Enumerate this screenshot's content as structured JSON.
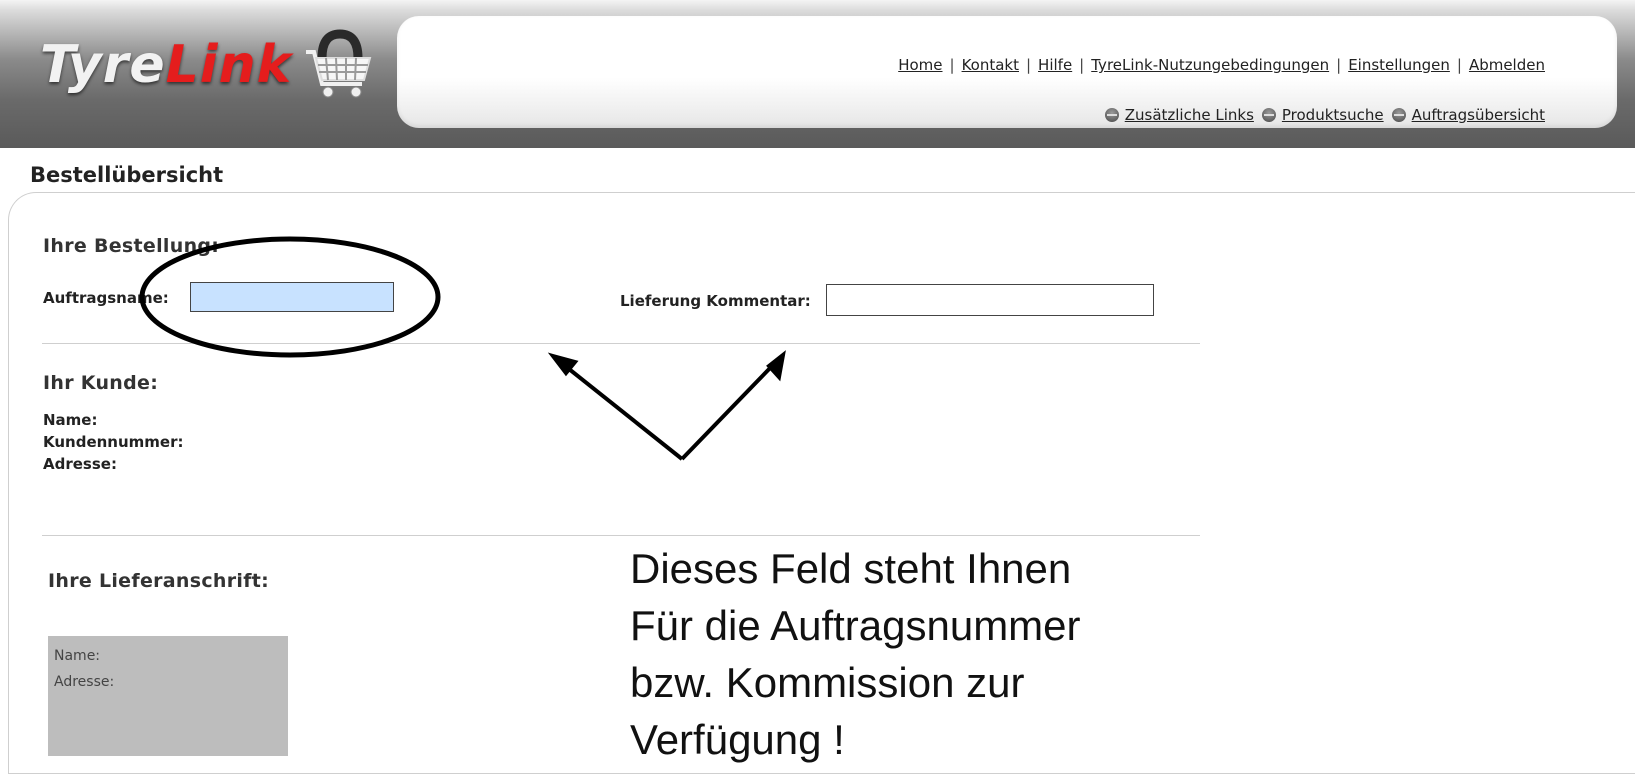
{
  "logo": {
    "part1": "Tyre",
    "part2": "Link"
  },
  "header": {
    "links": [
      "Home",
      "Kontakt",
      "Hilfe",
      "TyreLink-Nutzungebedingungen",
      "Einstellungen",
      "Abmelden"
    ],
    "separator": "|",
    "sublinks": [
      "Zusätzliche Links",
      "Produktsuche",
      "Auftragsübersicht"
    ]
  },
  "page": {
    "title": "Bestellübersicht"
  },
  "order": {
    "title": "Ihre Bestellung:",
    "auftragsname_label": "Auftragsname:",
    "auftragsname_value": "",
    "kommentar_label": "Lieferung Kommentar:",
    "kommentar_value": ""
  },
  "customer": {
    "title": "Ihr Kunde:",
    "name_label": "Name:",
    "number_label": "Kundennummer:",
    "address_label": "Adresse:"
  },
  "delivery": {
    "title": "Ihre Lieferanschrift:",
    "name_label": "Name:",
    "address_label": "Adresse:"
  },
  "annotation": {
    "lines": [
      "Dieses Feld steht Ihnen",
      "Für die Auftragsnummer",
      "bzw. Kommission zur",
      "Verfügung !"
    ]
  },
  "colors": {
    "logo_red": "#e51d1d",
    "active_input": "#c8e2ff",
    "delivery_box": "#bdbdbd"
  }
}
